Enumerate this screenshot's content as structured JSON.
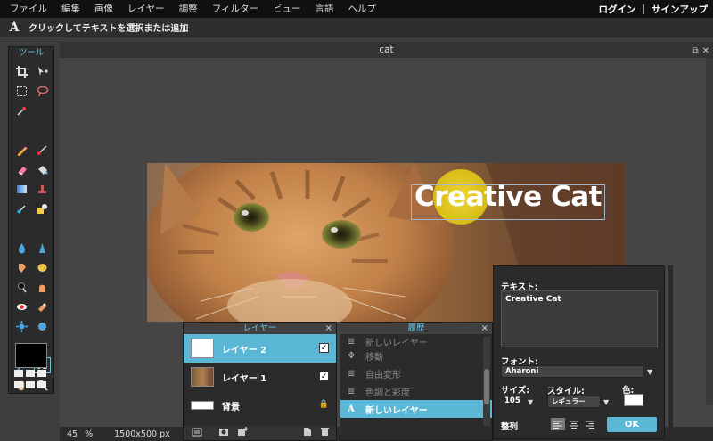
{
  "menu": [
    "ファイル",
    "編集",
    "画像",
    "レイヤー",
    "調整",
    "フィルター",
    "ビュー",
    "言語",
    "ヘルプ"
  ],
  "auth": {
    "login": "ログイン",
    "separator": "|",
    "signup": "サインアップ"
  },
  "options_bar": {
    "icon_glyph": "A",
    "hint": "クリックしてテキストを選択または追加"
  },
  "toolbox": {
    "title": "ツール",
    "text_tool_glyph": "A"
  },
  "document": {
    "title": "cat",
    "maximize": "⧉",
    "close": "✕"
  },
  "canvas": {
    "overlay_text": "Creative Cat"
  },
  "status": {
    "zoom": "45",
    "zoom_unit": "%",
    "size": "1500x500 px"
  },
  "layers": {
    "title": "レイヤー",
    "close": "×",
    "items": [
      {
        "name": "レイヤー 2",
        "selected": true,
        "check": "✓"
      },
      {
        "name": "レイヤー 1",
        "selected": false,
        "check": "✓"
      },
      {
        "name": "背景",
        "selected": false,
        "lock": "🔒"
      }
    ]
  },
  "history": {
    "title": "履歴",
    "close": "×",
    "items": [
      {
        "label": "新しいレイヤー",
        "icon": "≣"
      },
      {
        "label": "移動",
        "icon": "✥"
      },
      {
        "label": "自由変形",
        "icon": "≣"
      },
      {
        "label": "色調と彩度",
        "icon": "≣"
      },
      {
        "label": "新しいレイヤー",
        "icon": "A",
        "selected": true
      }
    ]
  },
  "text_panel": {
    "text_label": "テキスト:",
    "text_value": "Creative Cat",
    "font_label": "フォント:",
    "font_value": "Aharoni",
    "size_label": "サイズ:",
    "size_value": "105",
    "style_label": "スタイル:",
    "style_value": "レギュラー",
    "color_label": "色:",
    "align_label": "整列",
    "ok": "OK",
    "dropdown_arrow": "▼"
  },
  "colors": {
    "accent": "#5ab8d6",
    "highlight": "#e6d21c",
    "foreground": "#000000",
    "text_color": "#ffffff"
  }
}
